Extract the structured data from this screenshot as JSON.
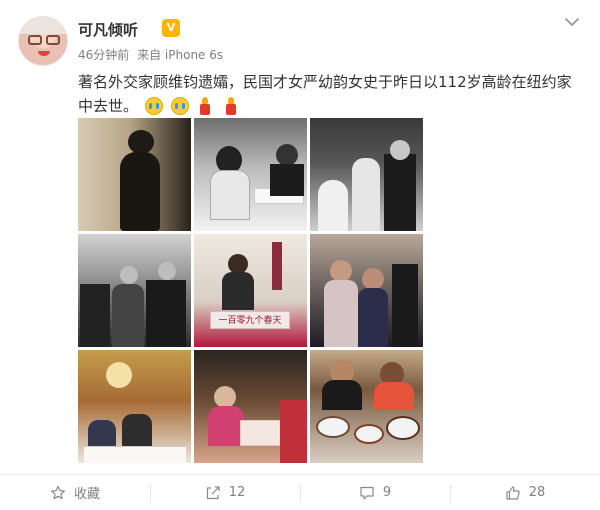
{
  "post": {
    "username": "可凡倾听",
    "badge_icon": "vip-badge-icon",
    "time": "46分钟前",
    "source": "来自 iPhone 6s",
    "text": "著名外交家顾维钧遗孀，民国才女严幼韵女史于昨日以112岁高龄在纽约家中去世。",
    "emojis": [
      "cry-face-icon",
      "cry-face-icon",
      "candle-icon",
      "candle-icon"
    ]
  },
  "photos": [
    {
      "name": "photo-lady-qipao"
    },
    {
      "name": "photo-banquet-bw"
    },
    {
      "name": "photo-wedding-bw"
    },
    {
      "name": "photo-group-bw"
    },
    {
      "name": "photo-book-cover",
      "book_title": "一百零九个春天"
    },
    {
      "name": "photo-toast-color"
    },
    {
      "name": "photo-party-room"
    },
    {
      "name": "photo-dinner-table"
    },
    {
      "name": "photo-dishes"
    }
  ],
  "actions": {
    "favorite_label": "收藏",
    "repost_count": "12",
    "comment_count": "9",
    "like_count": "28"
  },
  "colors": {
    "text": "#333333",
    "meta": "#808080",
    "badge": "#ffb400",
    "book_accent": "#9a1830"
  }
}
